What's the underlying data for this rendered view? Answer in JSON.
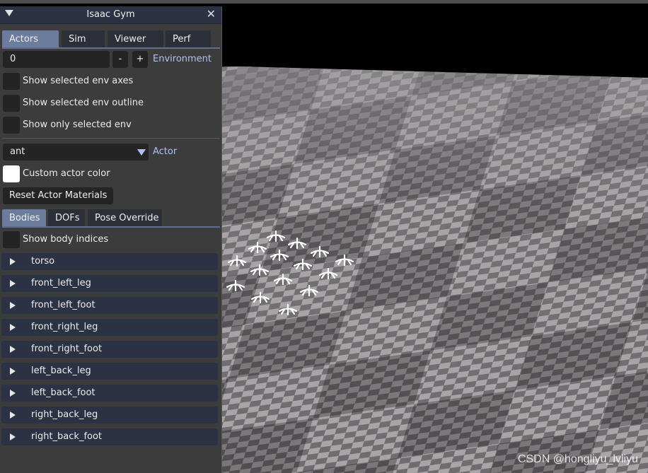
{
  "window": {
    "title": "Isaac Gym"
  },
  "main_tabs": [
    {
      "label": "Actors",
      "active": true
    },
    {
      "label": "Sim",
      "active": false
    },
    {
      "label": "Viewer",
      "active": false
    },
    {
      "label": "Perf",
      "active": false
    }
  ],
  "environment": {
    "value": "0",
    "decrement": "-",
    "increment": "+",
    "label": "Environment"
  },
  "env_checks": [
    {
      "label": "Show selected env axes",
      "checked": false
    },
    {
      "label": "Show selected env outline",
      "checked": false
    },
    {
      "label": "Show only selected env",
      "checked": false
    }
  ],
  "actor": {
    "value": "ant",
    "label": "Actor"
  },
  "custom_color": {
    "label": "Custom actor color"
  },
  "reset_button": "Reset Actor Materials",
  "sub_tabs": [
    {
      "label": "Bodies",
      "active": true
    },
    {
      "label": "DOFs",
      "active": false
    },
    {
      "label": "Pose Override",
      "active": false
    }
  ],
  "show_body_indices": {
    "label": "Show body indices",
    "checked": false
  },
  "bodies": [
    "torso",
    "front_left_leg",
    "front_left_foot",
    "front_right_leg",
    "front_right_foot",
    "left_back_leg",
    "left_back_foot",
    "right_back_leg",
    "right_back_foot"
  ],
  "colors": {
    "accent": "#aac3ee",
    "title_bg": "#2a3244",
    "active_tab": "#6b7c9c",
    "panel_bg": "#3c3c3c"
  },
  "watermark": "CSDN @hongliyu_lvliyu"
}
